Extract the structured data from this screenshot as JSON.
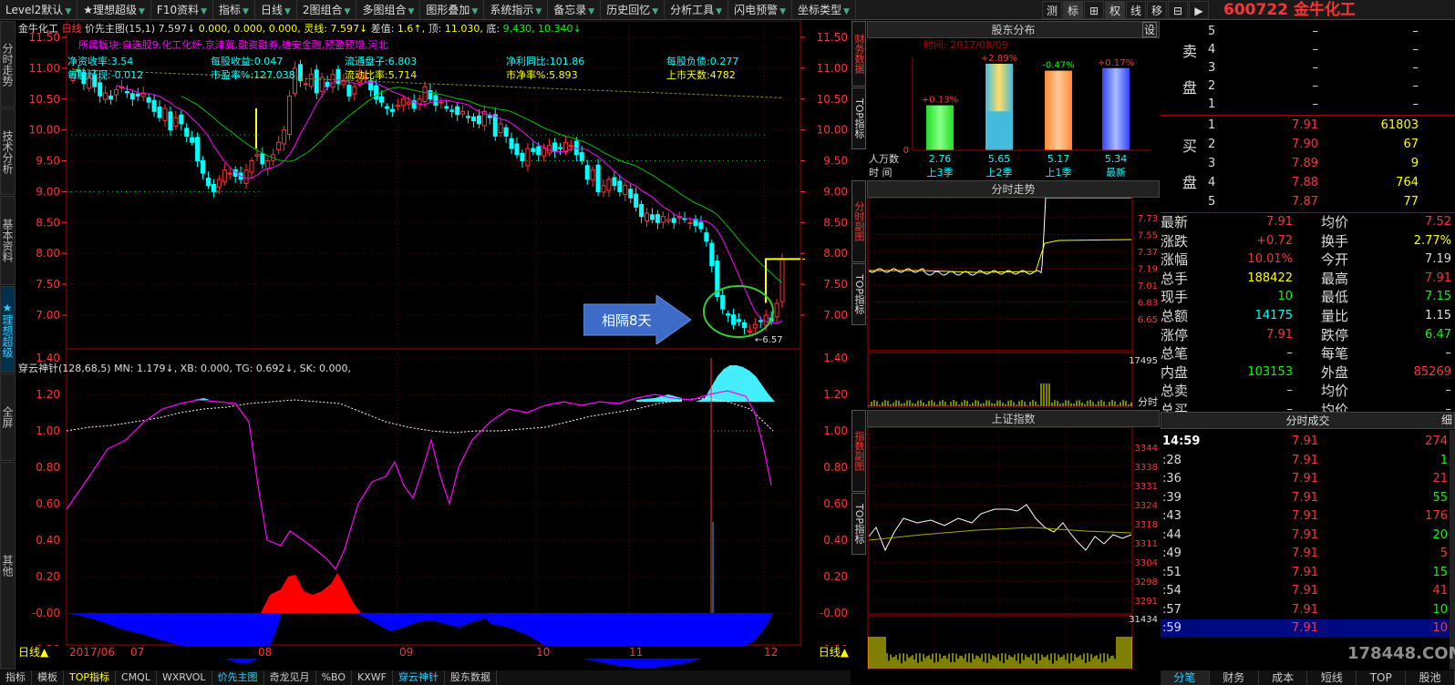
{
  "topbar": {
    "menu": [
      "Level2默认",
      "★理想超级",
      "F10资料",
      "指标",
      "日线",
      "2图组合",
      "多图组合",
      "图形叠加",
      "系统指示",
      "备忘录",
      "历史回忆",
      "分析工具",
      "闪电预警",
      "坐标类型"
    ],
    "tools": [
      "测",
      "标",
      "⊞",
      "权",
      "线",
      "移",
      "⊟",
      "▶"
    ],
    "stock_code": "600722",
    "stock_name": "金牛化工"
  },
  "leftnav": [
    "分时走势",
    "技术分析",
    "基本资料",
    "★理想超级",
    "全屏",
    "其他"
  ],
  "main_chart": {
    "header": {
      "name": "金牛化工",
      "period": "日线",
      "indicator": "价先主图(15,1)",
      "indicator_val": "7.597↓",
      "values": "0.000, 0.000, 0.000,",
      "lx_label": "灵线:",
      "lx_val": "7.597↓",
      "diff_label": "差值:",
      "diff_val": "1.6↑,",
      "top_label": "顶:",
      "top_val": "11.030,",
      "bot_label": "底:",
      "bot_val": "9.430, 10.340↓"
    },
    "info_line1": "所属板块:自选股9,化工化纤,京津冀,融资融券,雄安金融,预盈预增,河北",
    "info": [
      {
        "label": "净资收率:3.54",
        "row": 1,
        "col": 0
      },
      {
        "label": "每股收益:0.047",
        "row": 1,
        "col": 1
      },
      {
        "label": "流通盘子:6.803",
        "row": 1,
        "col": 2
      },
      {
        "label": "净利同比:101.86",
        "row": 1,
        "col": 3
      },
      {
        "label": "每股负债:0.277",
        "row": 1,
        "col": 4
      },
      {
        "label": "每股经现:-0.012",
        "row": 2,
        "col": 0
      },
      {
        "label": "市盈率%:127.038",
        "row": 2,
        "col": 1
      },
      {
        "label": "流动比率:5.714",
        "row": 2,
        "col": 2
      },
      {
        "label": "市净率%:5.893",
        "row": 2,
        "col": 3
      },
      {
        "label": "上市天数:4782",
        "row": 2,
        "col": 4
      }
    ],
    "y_ticks": [
      "11.50",
      "11.00",
      "10.50",
      "10.00",
      "9.50",
      "9.00",
      "8.50",
      "8.00",
      "7.50",
      "7.00"
    ],
    "annotation": "相隔8天",
    "low_label": "6.57",
    "sub_header": "穿云神针(128,68,5) MN: 1.179↓, XB: 0.000, TG: 0.692↓, SK: 0.000,",
    "sub_ticks": [
      "1.40",
      "1.20",
      "1.00",
      "0.80",
      "0.60",
      "0.40",
      "0.20",
      "-0.00",
      "-0.20"
    ],
    "x_labels": [
      "2017/06",
      "07",
      "08",
      "09",
      "10",
      "11",
      "12"
    ],
    "period_label": "日线▲"
  },
  "bottombar": [
    "指标",
    "模板",
    "TOP指标",
    "CMQL",
    "WXRVOL",
    "价先主图",
    "奇龙见月",
    "%BO",
    "KXWF",
    "穿云神针",
    "股东数据"
  ],
  "vtabs": [
    "财务数据",
    "TOP指标",
    "分时副图",
    "TOP指标",
    "指数副图",
    "TOP指标"
  ],
  "shareholder": {
    "title": "股东分布",
    "set_label": "设",
    "time_label": "时间: 2017/08/09",
    "row1_label": "人万数",
    "row2_label": "时 间",
    "bars": [
      {
        "pct": "+0.13%",
        "val": "2.76",
        "period": "上3季"
      },
      {
        "pct": "+2.89%",
        "val": "5.65",
        "period": "上2季"
      },
      {
        "pct": "-0.47%",
        "val": "5.17",
        "period": "上1季"
      },
      {
        "pct": "+0.17%",
        "val": "5.34",
        "period": "最新"
      }
    ],
    "bar_heights": [
      0.52,
      1.0,
      0.92,
      0.95
    ],
    "zero_label": "0"
  },
  "intraday": {
    "title": "分时走势",
    "ticks": [
      "7.73",
      "7.55",
      "7.37",
      "7.19",
      "7.01",
      "6.83",
      "6.65"
    ],
    "vol_label": "17495",
    "bottom_label": "分时"
  },
  "index": {
    "title": "上证指数",
    "ticks": [
      "3344",
      "3338",
      "3331",
      "3324",
      "3318",
      "3311",
      "3304",
      "3298",
      "3291"
    ],
    "vol_label": "31434"
  },
  "quote": {
    "sell_label": [
      "卖",
      "盘"
    ],
    "buy_label": [
      "买",
      "盘"
    ],
    "sells": [
      {
        "n": "5",
        "p": "–",
        "v": "–"
      },
      {
        "n": "4",
        "p": "–",
        "v": "–"
      },
      {
        "n": "3",
        "p": "–",
        "v": "–"
      },
      {
        "n": "2",
        "p": "–",
        "v": "–"
      },
      {
        "n": "1",
        "p": "–",
        "v": "–"
      }
    ],
    "buys": [
      {
        "n": "1",
        "p": "7.91",
        "v": "61803"
      },
      {
        "n": "2",
        "p": "7.90",
        "v": "67"
      },
      {
        "n": "3",
        "p": "7.89",
        "v": "9"
      },
      {
        "n": "4",
        "p": "7.88",
        "v": "764"
      },
      {
        "n": "5",
        "p": "7.87",
        "v": "77"
      }
    ],
    "stats": [
      {
        "l1": "最新",
        "v1": "7.91",
        "c1": "#ff3333",
        "l2": "均价",
        "v2": "7.52",
        "c2": "#ff3333"
      },
      {
        "l1": "涨跌",
        "v1": "+0.72",
        "c1": "#ff3333",
        "l2": "换手",
        "v2": "2.77%",
        "c2": "#ffff00"
      },
      {
        "l1": "涨幅",
        "v1": "10.01%",
        "c1": "#ff3333",
        "l2": "今开",
        "v2": "7.19",
        "c2": "#dddddd"
      },
      {
        "l1": "总手",
        "v1": "188422",
        "c1": "#ffff00",
        "l2": "最高",
        "v2": "7.91",
        "c2": "#ff3333"
      },
      {
        "l1": "现手",
        "v1": "10",
        "c1": "#00ff00",
        "l2": "最低",
        "v2": "7.15",
        "c2": "#00ff00"
      },
      {
        "l1": "总额",
        "v1": "14175",
        "c1": "#00ffff",
        "l2": "量比",
        "v2": "1.15",
        "c2": "#dddddd"
      },
      {
        "l1": "涨停",
        "v1": "7.91",
        "c1": "#ff3333",
        "l2": "跌停",
        "v2": "6.47",
        "c2": "#00ff00"
      },
      {
        "l1": "总笔",
        "v1": "–",
        "c1": "#dddddd",
        "l2": "每笔",
        "v2": "–",
        "c2": "#dddddd"
      },
      {
        "l1": "内盘",
        "v1": "103153",
        "c1": "#00ff00",
        "l2": "外盘",
        "v2": "85269",
        "c2": "#ff3333"
      },
      {
        "l1": "总卖",
        "v1": "–",
        "c1": "#dddddd",
        "l2": "均价",
        "v2": "–",
        "c2": "#dddddd"
      },
      {
        "l1": "总买",
        "v1": "–",
        "c1": "#dddddd",
        "l2": "均价",
        "v2": "–",
        "c2": "#dddddd"
      }
    ],
    "trades_title": "分时成交",
    "trades_btn": "细",
    "trades": [
      {
        "t": "14:59",
        "p": "7.91",
        "v": "274"
      },
      {
        "t": ":28",
        "p": "7.91",
        "v": "1"
      },
      {
        "t": ":36",
        "p": "7.91",
        "v": "21"
      },
      {
        "t": ":39",
        "p": "7.91",
        "v": "55"
      },
      {
        "t": ":43",
        "p": "7.91",
        "v": "176"
      },
      {
        "t": ":44",
        "p": "7.91",
        "v": "20"
      },
      {
        "t": ":49",
        "p": "7.91",
        "v": "5"
      },
      {
        "t": ":51",
        "p": "7.91",
        "v": "15"
      },
      {
        "t": ":54",
        "p": "7.91",
        "v": "41"
      },
      {
        "t": ":57",
        "p": "7.91",
        "v": "10"
      },
      {
        "t": ":59",
        "p": "7.91",
        "v": "10"
      }
    ],
    "tabs": [
      "分笔",
      "财务",
      "成本",
      "短线",
      "TOP",
      "股池"
    ]
  },
  "watermark": "178448.COM",
  "colors": {
    "up": "#ff3333",
    "down": "#00ffff",
    "axis": "#ff3333",
    "ma": "#00c000",
    "ma2": "#ff00ff",
    "bg": "#000000"
  }
}
